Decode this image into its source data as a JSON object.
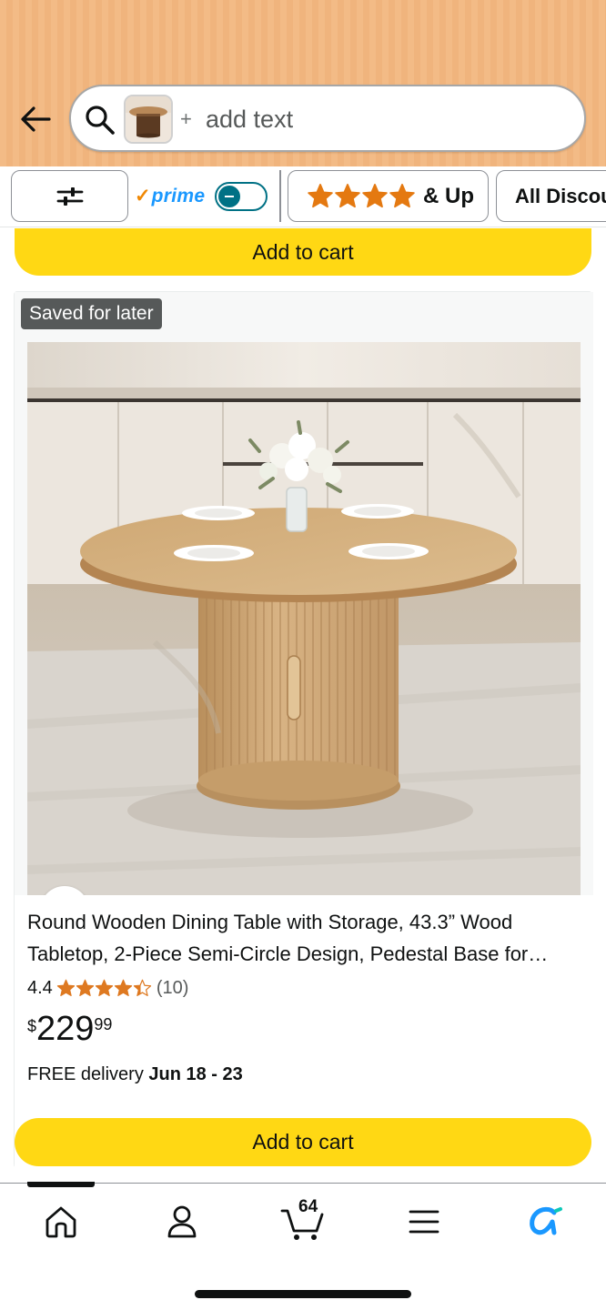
{
  "search": {
    "placeholder": "add text",
    "plus": "+"
  },
  "filters": {
    "prime_check": "✓",
    "prime_label": "prime",
    "prime_toggle_on": false,
    "rating_stars": 4,
    "rating_label": "& Up",
    "discount_label": "All Discounts"
  },
  "previous_item": {
    "add_to_cart": "Add to cart"
  },
  "product": {
    "badge": "Saved for later",
    "title": "Round Wooden Dining Table with Storage, 43.3” Wood Tabletop, 2-Piece Semi-Circle Design, Pedestal Base for Dining Room, Kitchen",
    "rating": "4.4",
    "rating_value": 4.4,
    "review_count": "(10)",
    "price_symbol": "$",
    "price_whole": "229",
    "price_fraction": "99",
    "delivery_prefix": "FREE delivery",
    "delivery_date": "Jun 18 - 23",
    "add_to_cart": "Add to cart"
  },
  "bottom_nav": {
    "cart_count": "64",
    "items": [
      "home",
      "account",
      "cart",
      "menu",
      "rufus"
    ]
  },
  "colors": {
    "header_bg": "#f3bb86",
    "cart_button": "#ffd814",
    "star": "#de7921",
    "prime_blue": "#1a98ff",
    "toggle": "#007185",
    "rufus_blue": "#1a98ff"
  }
}
